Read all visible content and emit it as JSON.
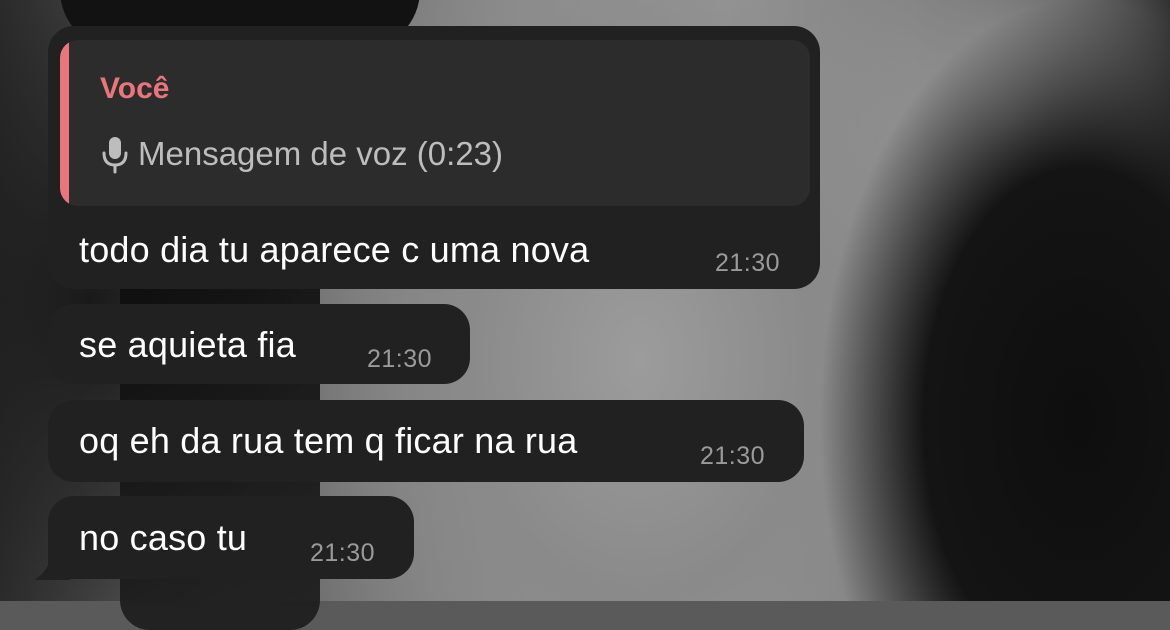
{
  "reply": {
    "author": "Você",
    "voice_label": "Mensagem de voz (0:23)",
    "icon": "microphone-icon"
  },
  "messages": [
    {
      "text": "todo dia tu aparece c uma nova",
      "time": "21:30"
    },
    {
      "text": "se aquieta fia",
      "time": "21:30"
    },
    {
      "text": "oq eh da rua tem q ficar na rua",
      "time": "21:30"
    },
    {
      "text": "no caso tu",
      "time": "21:30"
    }
  ],
  "colors": {
    "bubble": "#212121",
    "reply_accent": "#e8767c",
    "timestamp": "#9a9a9a"
  }
}
